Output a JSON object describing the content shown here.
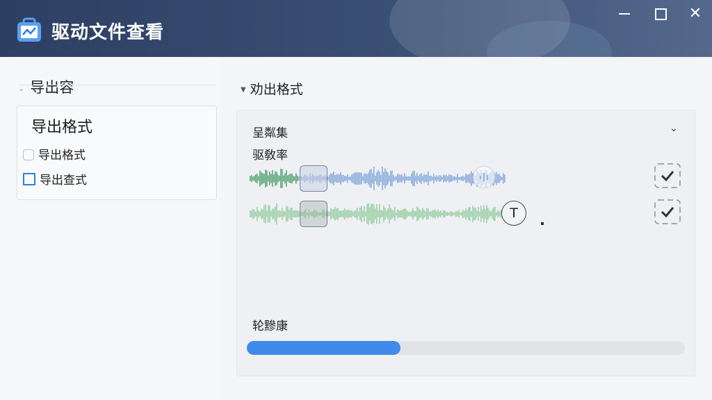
{
  "window": {
    "title": "驱动文件查看",
    "accent": "#2f7de2",
    "titlebar_color": "#2d3f63"
  },
  "left": {
    "header": "导出容",
    "card_title": "导出格式",
    "options": [
      {
        "label": "导出格式",
        "checked": false
      },
      {
        "label": "导出查式",
        "checked": false
      }
    ]
  },
  "right": {
    "header": "劝出格式",
    "panel_title": "呈粼集",
    "subtitle": "驱敎率",
    "text_button": "T",
    "progress_label": "轮黲康",
    "progress_fraction": 0.35
  }
}
